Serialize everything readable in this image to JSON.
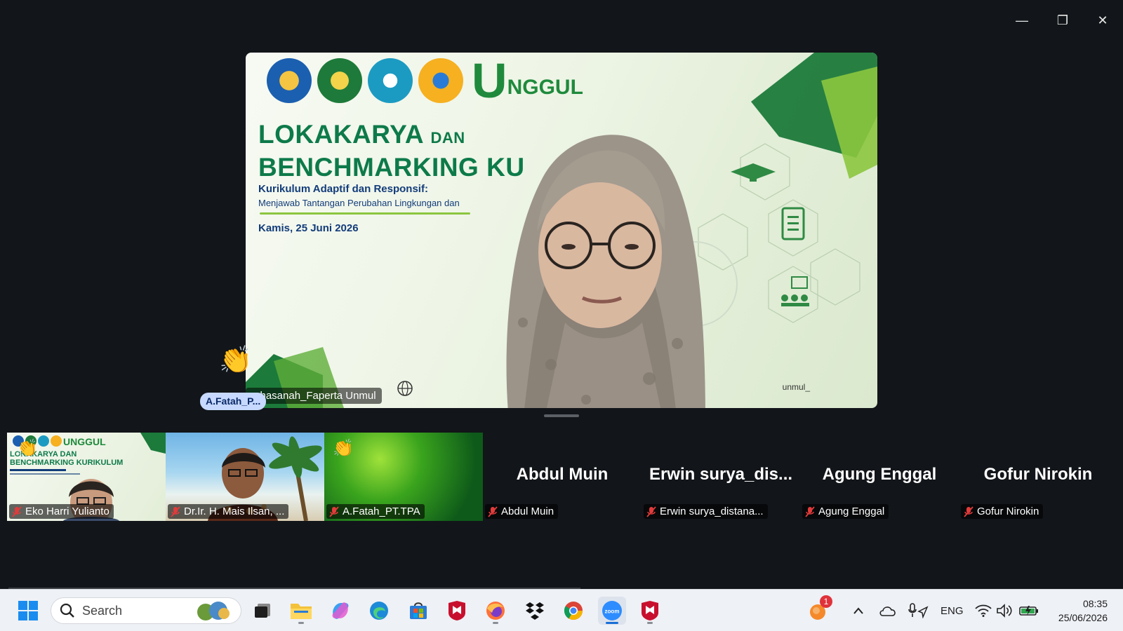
{
  "window": {
    "controls": {
      "minimize": "—",
      "restore": "❐",
      "close": "✕"
    }
  },
  "speaker": {
    "name": "...hasanah_Faperta Unmul",
    "corner_tag": "unmul_",
    "slide": {
      "brand": {
        "u": "U",
        "rest": "NGGUL"
      },
      "title_line1": "LOKAKARYA",
      "title_dan": "DAN",
      "title_line2": "BENCHMARKING KU",
      "subtitle1": "Kurikulum Adaptif dan Responsif:",
      "subtitle2": "Menjawab Tantangan Perubahan Lingkungan dan",
      "date": "Kamis, 25 Juni 2026"
    }
  },
  "raised_hand": {
    "name": "A.Fatah_P...",
    "emoji": "👏"
  },
  "gallery": [
    {
      "name": "Eko Harri Yulianto",
      "kind": "video-slide",
      "reaction": "👏"
    },
    {
      "name": "Dr.Ir. H. Mais Ilsan, ...",
      "kind": "video-beach"
    },
    {
      "name": "A.Fatah_PT.TPA",
      "kind": "video-green",
      "reaction": "👏"
    },
    {
      "name": "Abdul Muin",
      "display": "Abdul Muin",
      "kind": "no-video"
    },
    {
      "name": "Erwin surya_distana...",
      "display": "Erwin  surya_dis...",
      "kind": "no-video"
    },
    {
      "name": "Agung Enggal",
      "display": "Agung Enggal",
      "kind": "no-video"
    },
    {
      "name": "Gofur Nirokin",
      "display": "Gofur Nirokin",
      "kind": "no-video"
    }
  ],
  "taskbar": {
    "search_placeholder": "Search",
    "notification_count": "1",
    "language": "ENG",
    "time": "08:35",
    "date": "25/06/2026",
    "zoom_label": "zoom"
  },
  "colors": {
    "accent_green": "#1f8a3c",
    "title_teal": "#0d7a4a",
    "navy_text": "#123c7a",
    "hand_badge": "#c7d9ff"
  }
}
